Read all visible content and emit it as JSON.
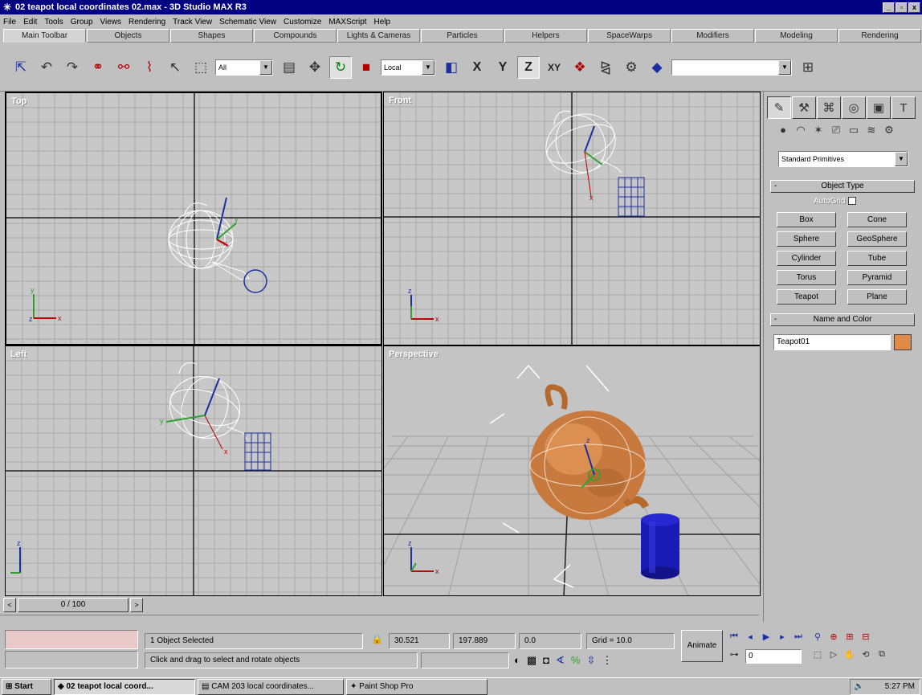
{
  "window": {
    "title": "02 teapot local coordinates 02.max - 3D Studio MAX R3",
    "buttons": [
      "_",
      "▫",
      "x"
    ]
  },
  "menu": [
    "File",
    "Edit",
    "Tools",
    "Group",
    "Views",
    "Rendering",
    "Track View",
    "Schematic View",
    "Customize",
    "MAXScript",
    "Help"
  ],
  "tabs": [
    "Main Toolbar",
    "Objects",
    "Shapes",
    "Compounds",
    "Lights & Cameras",
    "Particles",
    "Helpers",
    "SpaceWarps",
    "Modifiers",
    "Modeling",
    "Rendering"
  ],
  "toolbar": {
    "selection_filter": "All",
    "ref_coord": "Local",
    "axis_x": "X",
    "axis_y": "Y",
    "axis_z": "Z",
    "axis_xy": "XY",
    "named_sel": ""
  },
  "viewports": {
    "top": "Top",
    "front": "Front",
    "left": "Left",
    "perspective": "Perspective"
  },
  "command_panel": {
    "category": "Standard Primitives",
    "object_type_header": "Object Type",
    "autogrid": "AutoGrid",
    "buttons": [
      "Box",
      "Cone",
      "Sphere",
      "GeoSphere",
      "Cylinder",
      "Tube",
      "Torus",
      "Pyramid",
      "Teapot",
      "Plane"
    ],
    "name_color_header": "Name and Color",
    "name": "Teapot01",
    "color": "#e08a4a"
  },
  "time": {
    "slider": "0 / 100",
    "prev": "<",
    "next": ">"
  },
  "status": {
    "selected": "1 Object Selected",
    "prompt": "Click and drag to select and rotate objects",
    "x": "30.521",
    "y": "197.889",
    "z": "0.0",
    "grid": "Grid = 10.0",
    "animate": "Animate",
    "frame": "0"
  },
  "taskbar": {
    "start": "Start",
    "tasks": [
      "02 teapot local coord...",
      "CAM 203 local coordinates...",
      "Paint Shop Pro"
    ],
    "clock": "5:27 PM"
  }
}
